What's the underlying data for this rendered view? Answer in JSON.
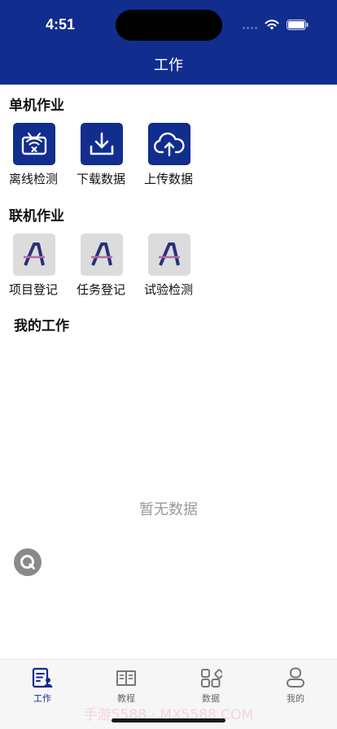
{
  "status_bar": {
    "time": "4:51"
  },
  "header": {
    "title": "工作"
  },
  "standalone": {
    "title": "单机作业",
    "items": [
      {
        "label": "离线检测",
        "icon": "offline-detect-icon"
      },
      {
        "label": "下载数据",
        "icon": "download-icon"
      },
      {
        "label": "上传数据",
        "icon": "cloud-upload-icon"
      }
    ]
  },
  "online": {
    "title": "联机作业",
    "items": [
      {
        "label": "项目登记",
        "icon": "app-logo-icon"
      },
      {
        "label": "任务登记",
        "icon": "app-logo-icon"
      },
      {
        "label": "试验检测",
        "icon": "app-logo-icon"
      }
    ]
  },
  "my_work": {
    "title": "我的工作",
    "empty_text": "暂无数据"
  },
  "tabbar": {
    "items": [
      {
        "label": "工作",
        "active": true
      },
      {
        "label": "教程",
        "active": false
      },
      {
        "label": "数据",
        "active": false
      },
      {
        "label": "我的",
        "active": false
      }
    ]
  },
  "watermark": "手游5588 · MX5588.COM",
  "colors": {
    "brand": "#112d8e",
    "muted": "#9a9a9a",
    "tile_gray": "#dcdcdc"
  }
}
